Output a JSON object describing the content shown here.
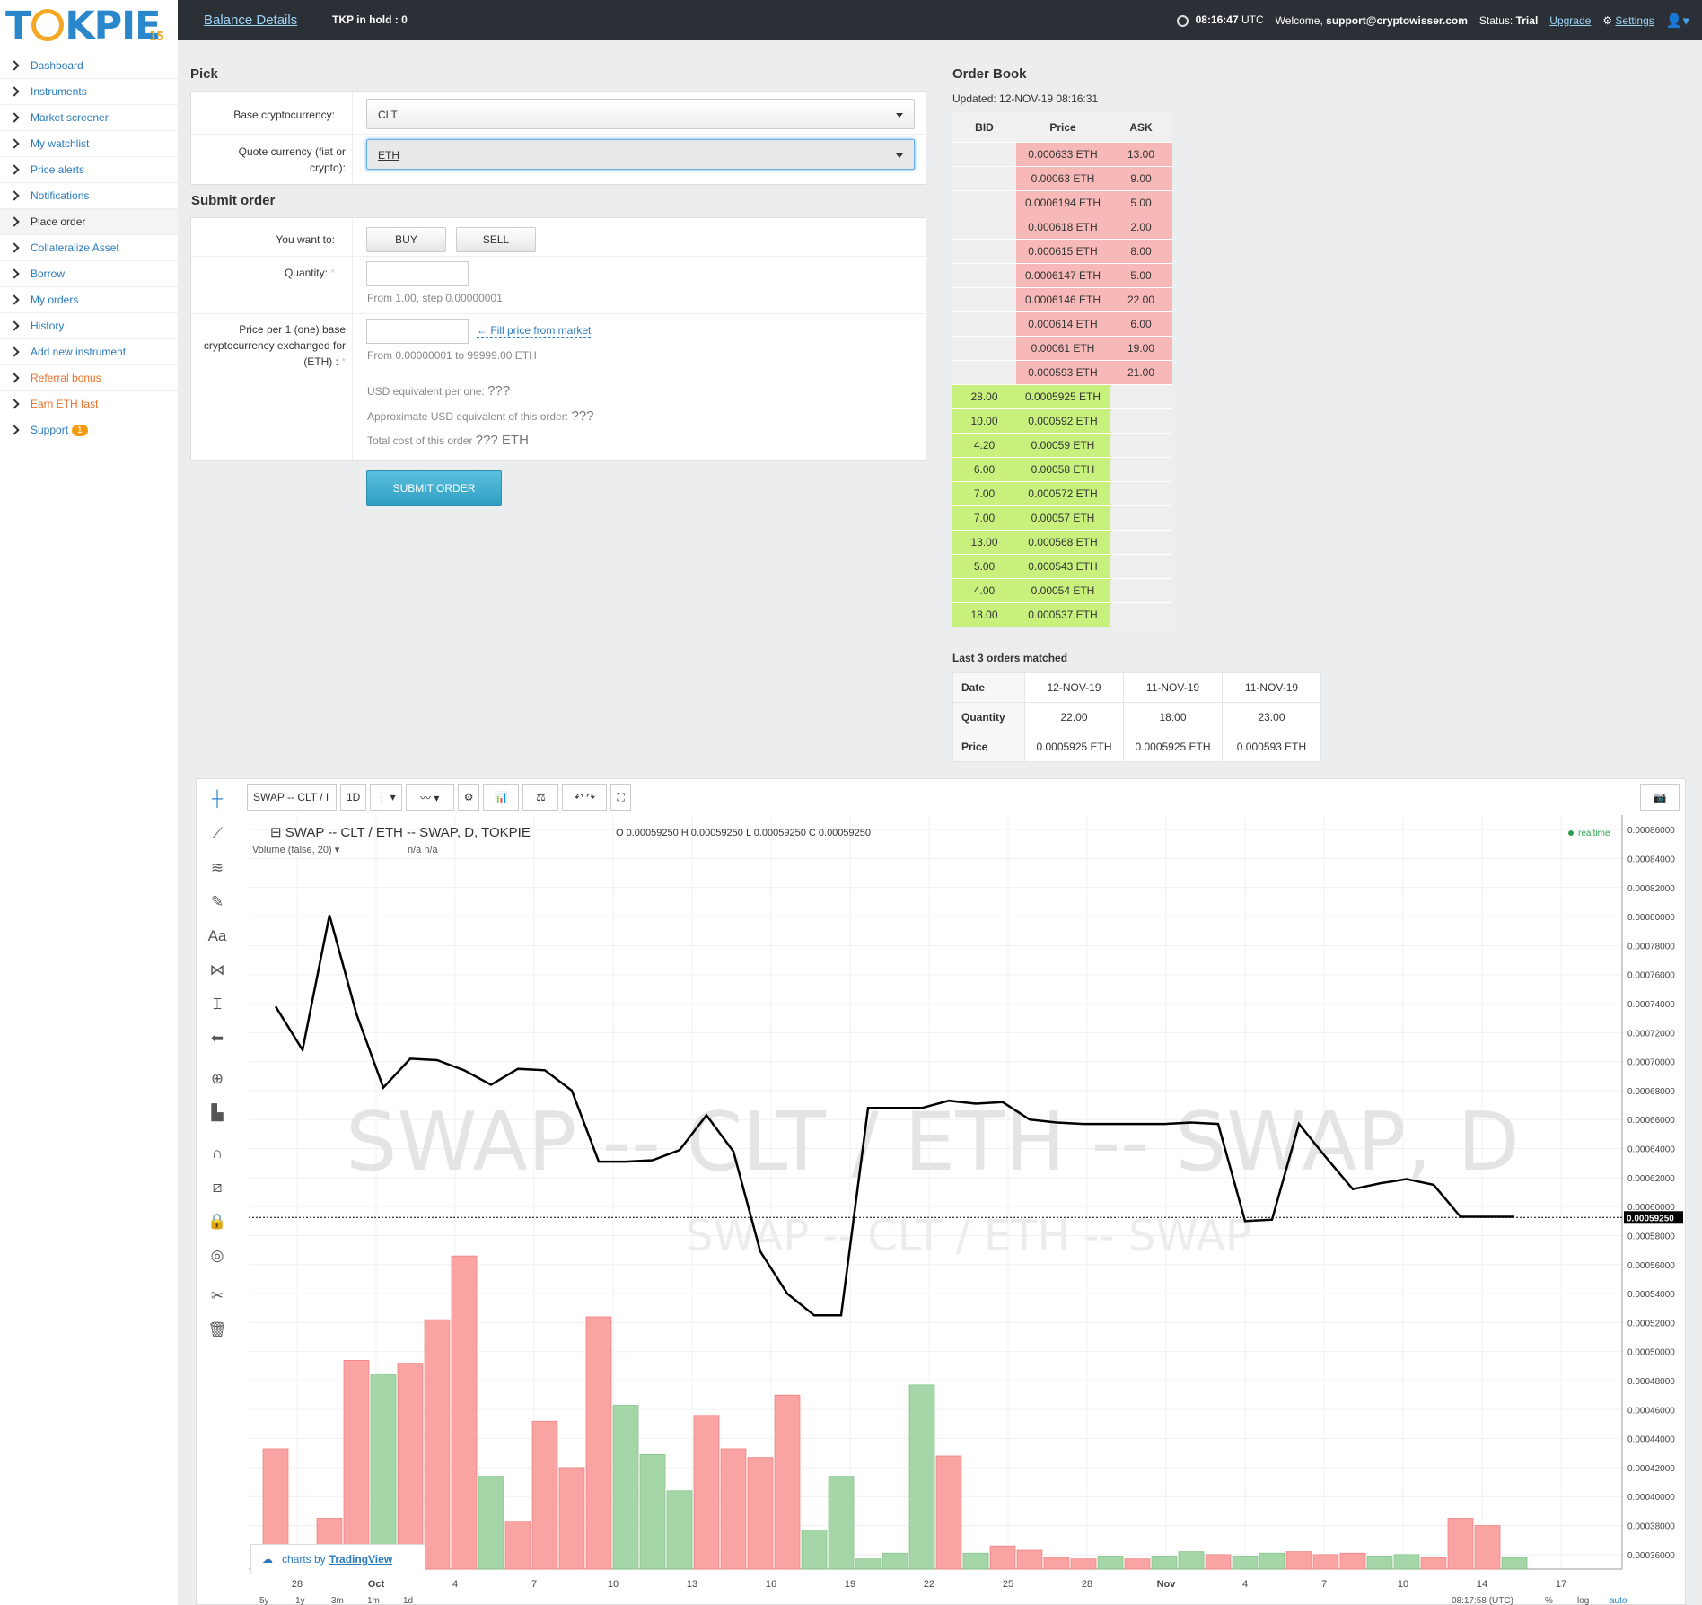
{
  "header": {
    "balance": "Balance Details",
    "hold": "TKP in hold : 0",
    "time": "08:16:47",
    "tz": "UTC",
    "welcome": "Welcome,",
    "email": "support@cryptowisser.com",
    "status_label": "Status:",
    "status": "Trial",
    "upgrade": "Upgrade",
    "settings": "Settings"
  },
  "logo": {
    "text": "TKPIE",
    "sub": "15"
  },
  "nav": [
    "Dashboard",
    "Instruments",
    "Market screener",
    "My watchlist",
    "Price alerts",
    "Notifications",
    "Place order",
    "Collateralize Asset",
    "Borrow",
    "My orders",
    "History",
    "Add new instrument",
    "Referral bonus",
    "Earn ETH fast",
    "Support"
  ],
  "support_badge": "1",
  "pick": {
    "title": "Pick",
    "base_label": "Base cryptocurrency:",
    "base_value": "CLT",
    "quote_label": "Quote currency (fiat or crypto):",
    "quote_value": "ETH"
  },
  "submit": {
    "title": "Submit order",
    "want_label": "You want to:",
    "buy": "BUY",
    "sell": "SELL",
    "qty_label": "Quantity:",
    "qty_hint": "From 1.00, step 0.00000001",
    "price_label": "Price per 1 (one) base cryptocurrency exchanged for (ETH) :",
    "fill": "← Fill price from market",
    "price_hint": "From 0.00000001 to 99999.00 ETH",
    "usd_one": "USD equivalent per one:",
    "usd_order": "Approximate USD equivalent of this order:",
    "total": "Total cost of this order",
    "qmarks": "???",
    "total_val": "??? ETH",
    "button": "SUBMIT ORDER"
  },
  "orderbook": {
    "title": "Order Book",
    "updated": "Updated: 12-NOV-19 08:16:31",
    "headers": [
      "BID",
      "Price",
      "ASK"
    ],
    "asks": [
      [
        "0.000633 ETH",
        "13.00"
      ],
      [
        "0.00063 ETH",
        "9.00"
      ],
      [
        "0.0006194 ETH",
        "5.00"
      ],
      [
        "0.000618 ETH",
        "2.00"
      ],
      [
        "0.000615 ETH",
        "8.00"
      ],
      [
        "0.0006147 ETH",
        "5.00"
      ],
      [
        "0.0006146 ETH",
        "22.00"
      ],
      [
        "0.000614 ETH",
        "6.00"
      ],
      [
        "0.00061 ETH",
        "19.00"
      ],
      [
        "0.000593 ETH",
        "21.00"
      ]
    ],
    "bids": [
      [
        "28.00",
        "0.0005925 ETH"
      ],
      [
        "10.00",
        "0.000592 ETH"
      ],
      [
        "4.20",
        "0.00059 ETH"
      ],
      [
        "6.00",
        "0.00058 ETH"
      ],
      [
        "7.00",
        "0.000572 ETH"
      ],
      [
        "7.00",
        "0.00057 ETH"
      ],
      [
        "13.00",
        "0.000568 ETH"
      ],
      [
        "5.00",
        "0.000543 ETH"
      ],
      [
        "4.00",
        "0.00054 ETH"
      ],
      [
        "18.00",
        "0.000537 ETH"
      ]
    ]
  },
  "last": {
    "title": "Last 3 orders matched",
    "rows": [
      [
        "Date",
        "12-NOV-19",
        "11-NOV-19",
        "11-NOV-19"
      ],
      [
        "Quantity",
        "22.00",
        "18.00",
        "23.00"
      ],
      [
        "Price",
        "0.0005925 ETH",
        "0.0005925 ETH",
        "0.000593 ETH"
      ]
    ]
  },
  "chart": {
    "symbol": "SWAP -- CLT / I",
    "interval": "1D",
    "legend": "SWAP -- CLT / ETH -- SWAP, D, TOKPIE",
    "ohlc": "O 0.00059250 H 0.00059250 L 0.00059250 C 0.00059250",
    "volume": "Volume (false, 20)",
    "na": "n/a n/a",
    "realtime": "realtime",
    "watermark": "SWAP -- CLT / ETH -- SWAP, D",
    "watermark2": "SWAP -- CLT / ETH -- SWAP",
    "last_label": "0.00059250",
    "tv": "charts by",
    "tv_brand": "TradingView",
    "yticks": [
      "0.00086000",
      "0.00084000",
      "0.00082000",
      "0.00080000",
      "0.00078000",
      "0.00076000",
      "0.00074000",
      "0.00072000",
      "0.00070000",
      "0.00068000",
      "0.00066000",
      "0.00064000",
      "0.00062000",
      "0.00060000",
      "0.00058000",
      "0.00056000",
      "0.00054000",
      "0.00052000",
      "0.00050000",
      "0.00048000",
      "0.00046000",
      "0.00044000",
      "0.00042000",
      "0.00040000",
      "0.00038000",
      "0.00036000"
    ],
    "xticks": [
      "28",
      "Oct",
      "4",
      "7",
      "10",
      "13",
      "16",
      "19",
      "22",
      "25",
      "28",
      "Nov",
      "4",
      "7",
      "10",
      "14",
      "17"
    ],
    "bottom": [
      "5y",
      "1y",
      "3m",
      "1m",
      "1d"
    ],
    "time": "08:17:58 (UTC)",
    "pct": "%",
    "log": "log",
    "auto": "auto"
  },
  "chart_data": {
    "type": "line",
    "title": "SWAP -- CLT / ETH -- SWAP, D, TOKPIE",
    "ylim": [
      0.00035,
      0.00087
    ],
    "price": [
      0.000738,
      0.000708,
      0.000801,
      0.000733,
      0.000682,
      0.000702,
      0.000701,
      0.000694,
      0.000684,
      0.000695,
      0.000694,
      0.00068,
      0.000631,
      0.000631,
      0.000632,
      0.000639,
      0.000663,
      0.000638,
      0.000569,
      0.00054,
      0.000525,
      0.000525,
      0.000668,
      0.000668,
      0.000668,
      0.000673,
      0.000671,
      0.000672,
      0.00066,
      0.000658,
      0.000657,
      0.000657,
      0.000657,
      0.000657,
      0.000658,
      0.000657,
      0.00059,
      0.000591,
      0.000657,
      0.000634,
      0.000612,
      0.000616,
      0.000619,
      0.000615,
      0.000593,
      0.000593,
      0.000593
    ],
    "volume": [
      0.000433,
      0,
      0.000385,
      0.000494,
      0.000484,
      0.000492,
      0.000522,
      0.000566,
      0.000414,
      0.000383,
      0.000452,
      0.00042,
      0.000524,
      0.000463,
      0.000429,
      0.000404,
      0.000456,
      0.000433,
      0.000427,
      0.00047,
      0.000377,
      0.000414,
      0.000357,
      0.000361,
      0.000477,
      0.000428,
      0.000361,
      0.000366,
      0.000363,
      0.000358,
      0.000357,
      0.000359,
      0.000357,
      0.000359,
      0.000362,
      0.00036,
      0.000359,
      0.000361,
      0.000362,
      0.00036,
      0.000361,
      0.000359,
      0.00036,
      0.000358,
      0.000385,
      0.00038,
      0.000358
    ],
    "vol_colors": [
      "r",
      "r",
      "r",
      "r",
      "g",
      "r",
      "r",
      "r",
      "g",
      "r",
      "r",
      "r",
      "r",
      "g",
      "g",
      "g",
      "r",
      "r",
      "r",
      "r",
      "g",
      "g",
      "g",
      "g",
      "g",
      "r",
      "g",
      "r",
      "r",
      "r",
      "r",
      "g",
      "r",
      "g",
      "g",
      "r",
      "g",
      "g",
      "r",
      "r",
      "r",
      "g",
      "g",
      "r",
      "r",
      "r",
      "g"
    ]
  }
}
